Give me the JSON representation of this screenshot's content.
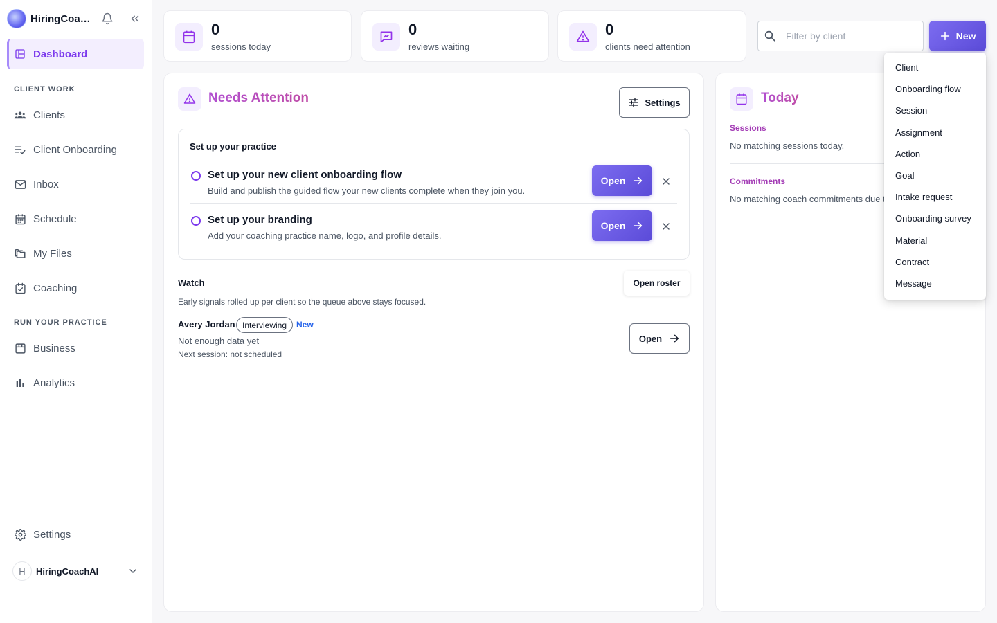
{
  "brand": {
    "name": "HiringCoachAI"
  },
  "sidebar": {
    "dashboard": "Dashboard",
    "section_client_work": "CLIENT WORK",
    "clients": "Clients",
    "client_onboarding": "Client Onboarding",
    "inbox": "Inbox",
    "schedule": "Schedule",
    "my_files": "My Files",
    "coaching": "Coaching",
    "section_run_practice": "RUN YOUR PRACTICE",
    "business": "Business",
    "analytics": "Analytics",
    "settings": "Settings",
    "user_initial": "H",
    "user_name": "HiringCoachAI"
  },
  "stats": [
    {
      "value": "0",
      "label": "sessions today"
    },
    {
      "value": "0",
      "label": "reviews waiting"
    },
    {
      "value": "0",
      "label": "clients need attention"
    }
  ],
  "filter": {
    "placeholder": "Filter by client"
  },
  "new_button": {
    "label": "New"
  },
  "needs_attention": {
    "title": "Needs Attention",
    "settings_label": "Settings",
    "setup_title": "Set up your practice",
    "tasks": [
      {
        "title": "Set up your new client onboarding flow",
        "desc": "Build and publish the guided flow your new clients complete when they join you.",
        "action": "Open"
      },
      {
        "title": "Set up your branding",
        "desc": "Add your coaching practice name, logo, and profile details.",
        "action": "Open"
      }
    ],
    "watch_title": "Watch",
    "open_roster": "Open roster",
    "watch_sub": "Early signals rolled up per client so the queue above stays focused.",
    "client": {
      "name": "Avery Jordan",
      "stage": "Interviewing",
      "badge": "New",
      "data": "Not enough data yet",
      "next": "Next session: not scheduled",
      "action": "Open"
    }
  },
  "today": {
    "title": "Today",
    "sessions_label": "Sessions",
    "sessions_empty": "No matching sessions today.",
    "commitments_label": "Commitments",
    "commitments_empty": "No matching coach commitments due t"
  },
  "new_menu": {
    "items": [
      "Client",
      "Onboarding flow",
      "Session",
      "Assignment",
      "Action",
      "Goal",
      "Intake request",
      "Onboarding survey",
      "Material",
      "Contract",
      "Message"
    ]
  },
  "colors": {
    "accent": "#7c3aed",
    "primary_button": "#6b5ce7",
    "title_gradient": "#b14fd0",
    "link_blue": "#2563eb"
  }
}
